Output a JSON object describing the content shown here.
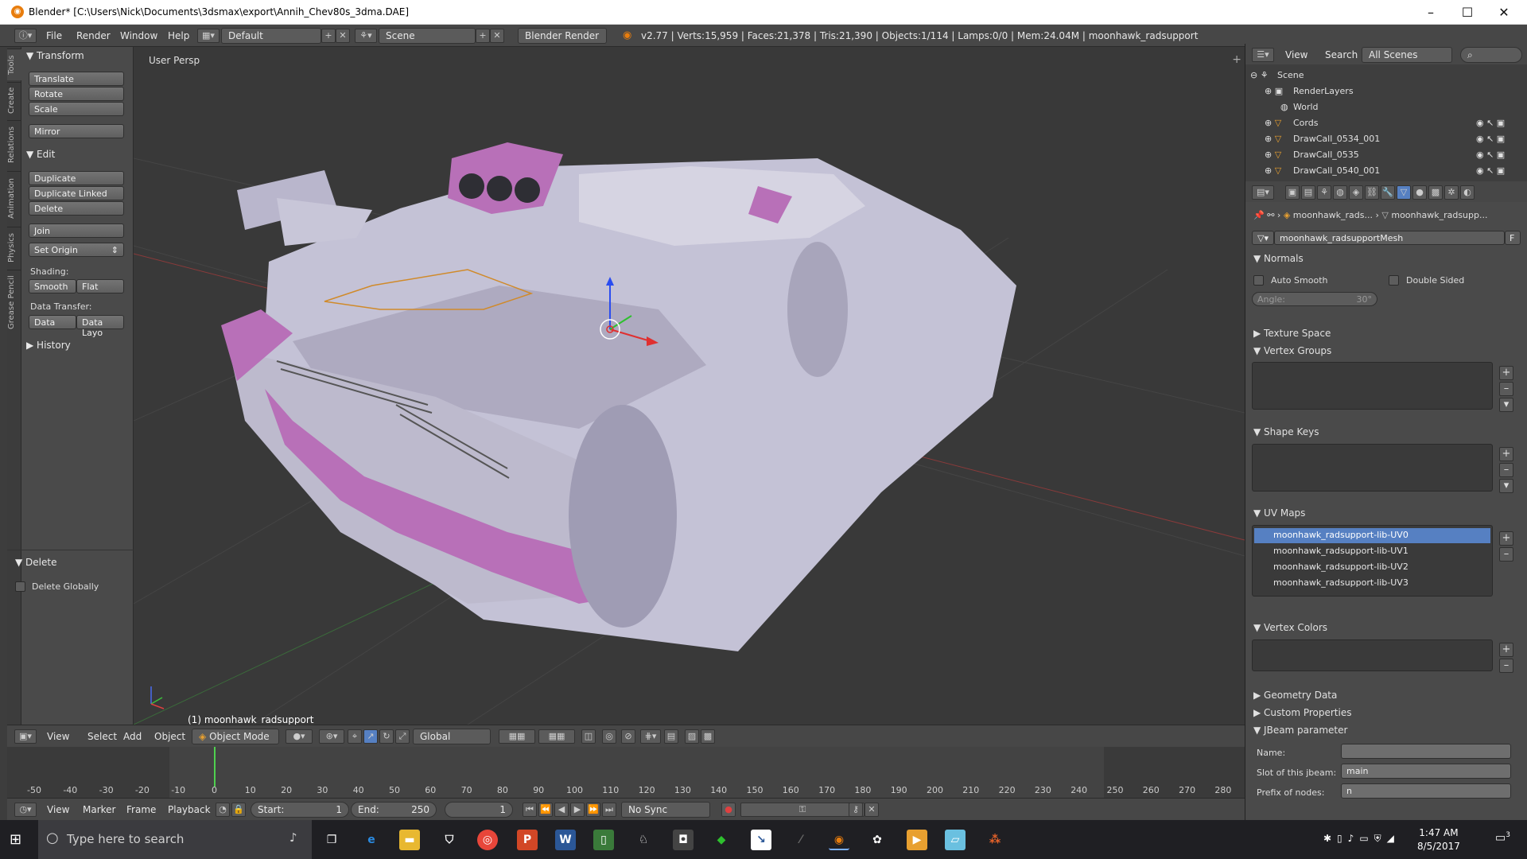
{
  "window": {
    "title": "Blender* [C:\\Users\\Nick\\Documents\\3dsmax\\export\\Annih_Chev80s_3dma.DAE]"
  },
  "infobar": {
    "menus": [
      "File",
      "Render",
      "Window",
      "Help"
    ],
    "layout": "Default",
    "scene": "Scene",
    "engine": "Blender Render",
    "stats": "v2.77 | Verts:15,959 | Faces:21,378 | Tris:21,390 | Objects:1/114 | Lamps:0/0 | Mem:24.04M | moonhawk_radsupport"
  },
  "left_tabs": [
    "Tools",
    "Create",
    "Relations",
    "Animation",
    "Physics",
    "Grease Pencil"
  ],
  "toolshelf": {
    "transform": {
      "header": "Transform",
      "buttons": [
        "Translate",
        "Rotate",
        "Scale",
        "Mirror"
      ]
    },
    "edit": {
      "header": "Edit",
      "buttons": [
        "Duplicate",
        "Duplicate Linked",
        "Delete",
        "Join",
        "Set Origin"
      ],
      "shading_label": "Shading:",
      "smooth": "Smooth",
      "flat": "Flat",
      "transfer_label": "Data Transfer:",
      "data": "Data",
      "data_layo": "Data Layo"
    },
    "history": "History",
    "operator": {
      "header": "Delete",
      "checkbox": "Delete Globally"
    }
  },
  "viewport": {
    "label": "User Persp",
    "object_label": "(1) moonhawk_radsupport"
  },
  "view3d_header": {
    "menus": [
      "View",
      "Select",
      "Add",
      "Object"
    ],
    "mode": "Object Mode",
    "orientation": "Global"
  },
  "timeline": {
    "ticks": [
      "-50",
      "-40",
      "-30",
      "-20",
      "-10",
      "0",
      "10",
      "20",
      "30",
      "40",
      "50",
      "60",
      "70",
      "80",
      "90",
      "100",
      "110",
      "120",
      "130",
      "140",
      "150",
      "160",
      "170",
      "180",
      "190",
      "200",
      "210",
      "220",
      "230",
      "240",
      "250",
      "260",
      "270",
      "280"
    ],
    "current_frame_value": 0
  },
  "timeline_header": {
    "menus": [
      "View",
      "Marker",
      "Frame",
      "Playback"
    ],
    "start_label": "Start:",
    "start": "1",
    "end_label": "End:",
    "end": "250",
    "current": "1",
    "sync": "No Sync"
  },
  "outliner": {
    "menus": [
      "View",
      "Search"
    ],
    "filter": "All Scenes",
    "rows": [
      {
        "label": "Scene"
      },
      {
        "label": "RenderLayers"
      },
      {
        "label": "World"
      },
      {
        "label": "Cords"
      },
      {
        "label": "DrawCall_0534_001"
      },
      {
        "label": "DrawCall_0535"
      },
      {
        "label": "DrawCall_0540_001"
      }
    ]
  },
  "properties": {
    "breadcrumb": [
      "moonhawk_rads...",
      "moonhawk_radsupp..."
    ],
    "mesh_name": "moonhawk_radsupportMesh",
    "fake_user": "F",
    "normals": {
      "header": "Normals",
      "auto_smooth": "Auto Smooth",
      "double_sided": "Double Sided",
      "angle": "Angle:",
      "angle_value": "30°"
    },
    "texture_space": "Texture Space",
    "vertex_groups": "Vertex Groups",
    "shape_keys": "Shape Keys",
    "uv_maps": {
      "header": "UV Maps",
      "items": [
        "moonhawk_radsupport-lib-UV0",
        "moonhawk_radsupport-lib-UV1",
        "moonhawk_radsupport-lib-UV2",
        "moonhawk_radsupport-lib-UV3"
      ]
    },
    "vertex_colors": "Vertex Colors",
    "geometry_data": "Geometry Data",
    "custom_properties": "Custom Properties",
    "jbeam": {
      "header": "JBeam parameter",
      "name_label": "Name:",
      "name_value": "",
      "slot_label": "Slot of this jbeam:",
      "slot_value": "main",
      "prefix_label": "Prefix of nodes:",
      "prefix_value": "n"
    }
  },
  "taskbar": {
    "search_placeholder": "Type here to search",
    "time": "1:47 AM",
    "date": "8/5/2017",
    "notification_count": "3"
  },
  "colors": {
    "blender_orange": "#e87d0d",
    "selection_blue": "#5680c2",
    "car_body": "#c4c2d6",
    "car_trim": "#b870b8"
  }
}
